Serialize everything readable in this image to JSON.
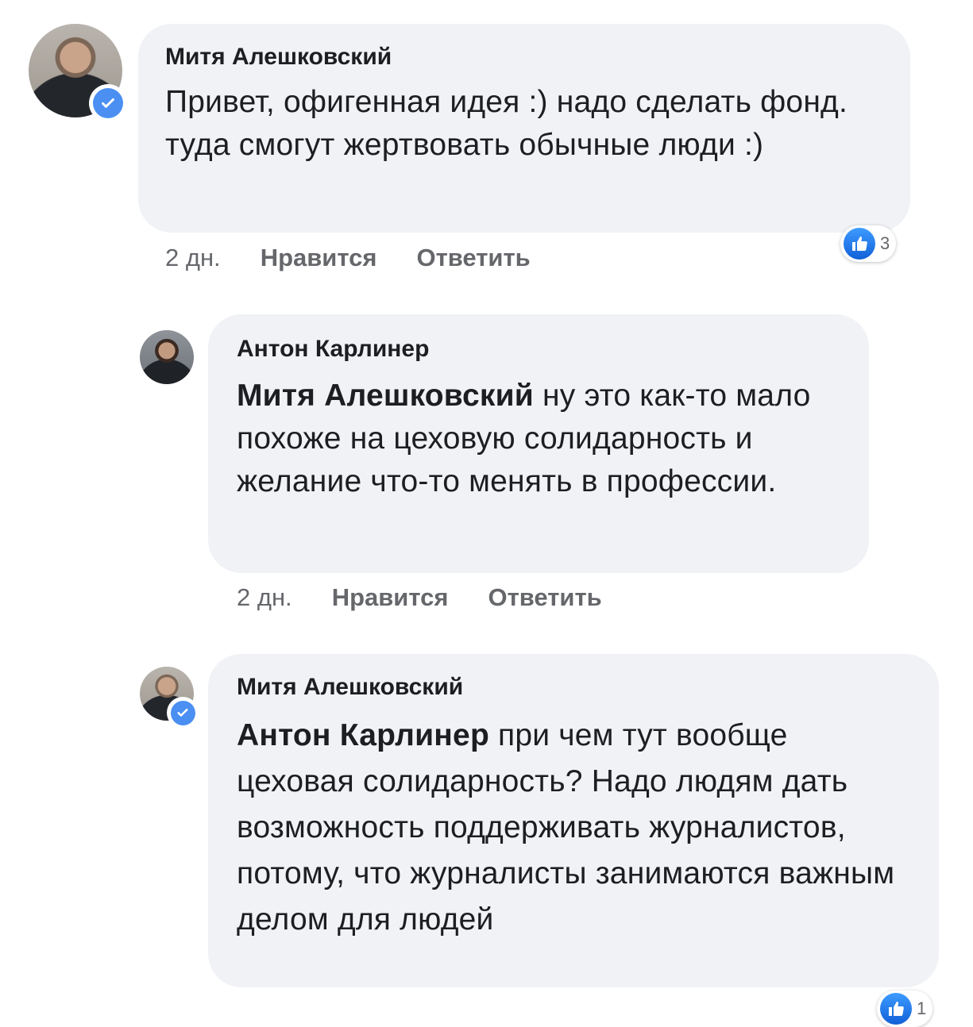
{
  "comments": [
    {
      "author": "Митя Алешковский",
      "mention": "",
      "text": "Привет, офигенная идея :) надо сделать фонд. туда смогут жертвовать обычные люди :)",
      "time": "2 дн.",
      "like_label": "Нравится",
      "reply_label": "Ответить",
      "reactions": "3",
      "verified": true
    },
    {
      "author": "Антон Карлинер",
      "mention": "Митя Алешковский",
      "text": "ну это как-то мало похоже на цеховую солидарность и желание что-то менять в профессии.",
      "time": "2 дн.",
      "like_label": "Нравится",
      "reply_label": "Ответить",
      "verified": false
    },
    {
      "author": "Митя Алешковский",
      "mention": "Антон Карлинер",
      "text": "при чем тут вообще цеховая солидарность? Надо людям дать возможность поддерживать журналистов, потому, что журналисты занимаются важным делом для людей",
      "reactions": "1",
      "verified": true
    }
  ],
  "icons": {
    "verified": "verified-check-icon",
    "like": "thumbs-up-icon"
  },
  "colors": {
    "bubble": "#f0f2f5",
    "meta_text": "#65676b",
    "verified_blue": "#4b8ff2",
    "like_blue": "#1877f2"
  }
}
